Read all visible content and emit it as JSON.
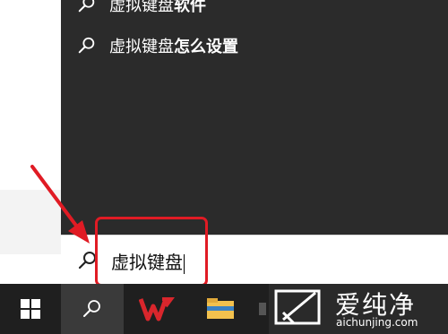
{
  "search_flyout": {
    "suggestions": [
      {
        "query": "虚拟键盘",
        "suffix": "软件"
      },
      {
        "query": "虚拟键盘",
        "suffix": "怎么设置"
      }
    ]
  },
  "search_box": {
    "value": "虚拟键盘"
  },
  "taskbar": {
    "items": [
      "windows-start",
      "search",
      "wps-office",
      "file-explorer",
      "edge"
    ]
  },
  "watermark": {
    "brand": "爱纯净",
    "url": "aichunjing.com"
  },
  "colors": {
    "flyout_bg": "#2b2b2b",
    "taskbar_bg": "#1f1f1f",
    "highlight": "#e01b24",
    "wps_red": "#d9262c",
    "folder_yellow": "#f2c14e"
  }
}
